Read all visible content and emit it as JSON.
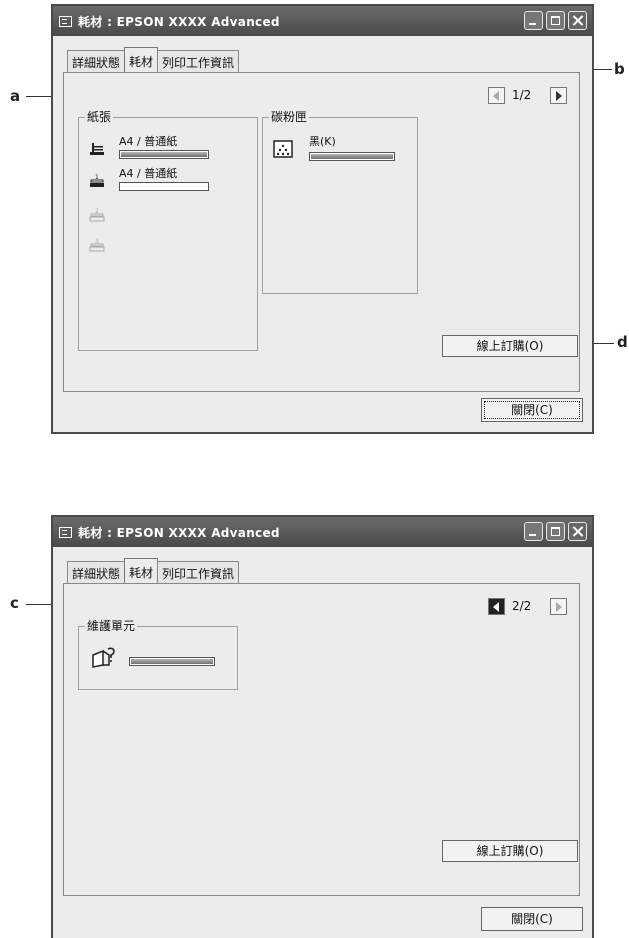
{
  "window1": {
    "title": "耗材 : EPSON  XXXX  Advanced",
    "tabs": [
      "詳細狀態",
      "耗材",
      "列印工作資訊"
    ],
    "page_indicator": "1/2",
    "paper_group": {
      "title": "紙張",
      "trays": [
        {
          "label": "A4  /  普通紙",
          "icon": "paper-tray-mp-icon",
          "level": 1.0
        },
        {
          "label": "A4  /  普通紙",
          "icon": "paper-tray-1-icon",
          "level": 0.0
        },
        {
          "label": "",
          "icon": "paper-tray-2-icon-disabled",
          "level": null
        },
        {
          "label": "",
          "icon": "paper-tray-3-icon-disabled",
          "level": null
        }
      ]
    },
    "toner_group": {
      "title": "碳粉匣",
      "items": [
        {
          "label": "黑(K)",
          "icon": "toner-cartridge-icon",
          "level": 1.0
        }
      ]
    },
    "order_online_button": "線上訂購(O)",
    "close_button": "關閉(C)"
  },
  "window2": {
    "title": "耗材 : EPSON  XXXX  Advanced",
    "tabs": [
      "詳細狀態",
      "耗材",
      "列印工作資訊"
    ],
    "page_indicator": "2/2",
    "maintenance_group": {
      "title": "維護單元",
      "items": [
        {
          "icon": "maintenance-unit-icon",
          "level": 1.0
        }
      ]
    },
    "order_online_button": "線上訂購(O)",
    "close_button": "關閉(C)"
  },
  "callouts": {
    "a": "a",
    "b": "b",
    "c": "c",
    "d": "d"
  }
}
